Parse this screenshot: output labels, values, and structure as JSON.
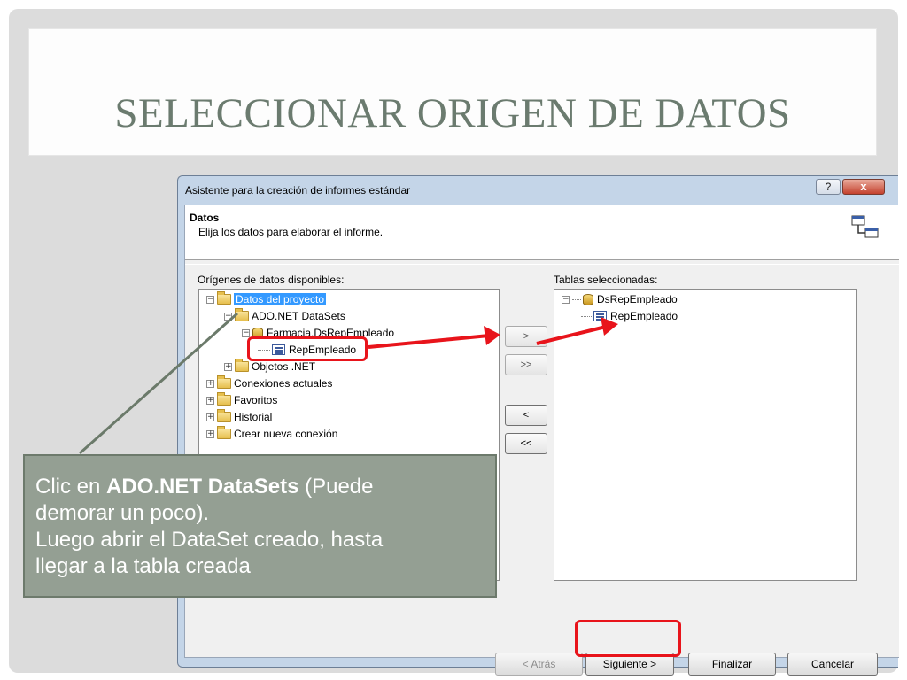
{
  "slide": {
    "title": "SELECCIONAR ORIGEN DE DATOS"
  },
  "dialog": {
    "title": "Asistente para la creación de informes estándar",
    "help_label": "?",
    "close_label": "x",
    "header_title": "Datos",
    "header_subtitle": "Elija los datos para elaborar el informe.",
    "available_label": "Orígenes de datos disponibles:",
    "selected_label": "Tablas seleccionadas:",
    "available_tree": [
      {
        "label": "Datos del proyecto",
        "expander": "−"
      },
      {
        "label": "ADO.NET DataSets",
        "expander": "−"
      },
      {
        "label": "Farmacia.DsRepEmpleado",
        "expander": "−"
      },
      {
        "label": "RepEmpleado",
        "expander": ""
      },
      {
        "label": "Objetos .NET",
        "expander": "+"
      },
      {
        "label": "Conexiones actuales",
        "expander": "+"
      },
      {
        "label": "Favoritos",
        "expander": "+"
      },
      {
        "label": "Historial",
        "expander": "+"
      },
      {
        "label": "Crear nueva conexión",
        "expander": "+"
      }
    ],
    "selected_tree": [
      {
        "label": "DsRepEmpleado",
        "expander": "−"
      },
      {
        "label": "RepEmpleado",
        "expander": ""
      }
    ],
    "move_buttons": {
      "add": ">",
      "add_all": ">>",
      "remove": "<",
      "remove_all": "<<"
    },
    "footer": {
      "back": "< Atrás",
      "next": "Siguiente >",
      "finish": "Finalizar",
      "cancel": "Cancelar"
    }
  },
  "callout": {
    "prefix": "Clic en ",
    "bold": "ADO.NET DataSets",
    "line1_rest": " (Puede",
    "line2": "demorar un poco).",
    "line3": "Luego abrir el DataSet creado, hasta",
    "line4": "llegar a la tabla creada"
  },
  "colors": {
    "highlight": "#e8141b",
    "selection": "#3399ff",
    "callout_bg": "#949f93",
    "title_text": "#6b7b6f"
  }
}
